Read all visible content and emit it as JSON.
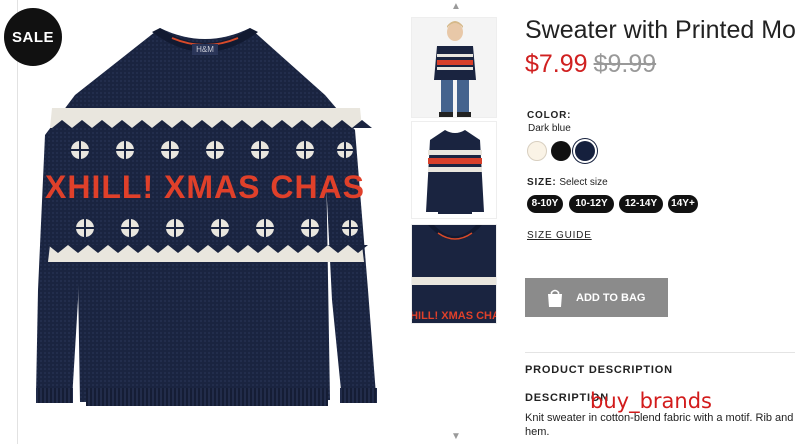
{
  "badge": {
    "sale": "SALE"
  },
  "sweater_print": {
    "main_text": "XHILL! XMAS CHAS",
    "brand_tag": "H&M",
    "thumb_text": "XHILL! XMAS CHAS"
  },
  "product": {
    "title": "Sweater with Printed Mo",
    "price_sale": "$7.99",
    "price_original": "$9.99"
  },
  "color": {
    "label": "COLOR:",
    "selected": "Dark blue",
    "swatches": [
      "#faf3e6",
      "#111111",
      "#15203d"
    ]
  },
  "size": {
    "label": "SIZE:",
    "hint": "Select size",
    "options": [
      "8-10Y",
      "10-12Y",
      "12-14Y",
      "14Y+"
    ],
    "guide": "SIZE GUIDE"
  },
  "actions": {
    "add_to_bag": "ADD TO BAG"
  },
  "description": {
    "section_title": "PRODUCT DESCRIPTION",
    "label": "DESCRIPTION",
    "text": "Knit sweater in cotton-blend fabric with a motif. Rib and hem."
  },
  "watermark": "buy_brands",
  "icons": [
    "chevron-up-icon",
    "chevron-down-icon",
    "shopping-bag-icon"
  ],
  "colors": {
    "sale_red": "#d02020",
    "navy": "#15203d",
    "button_gray": "#8b8b8b"
  }
}
